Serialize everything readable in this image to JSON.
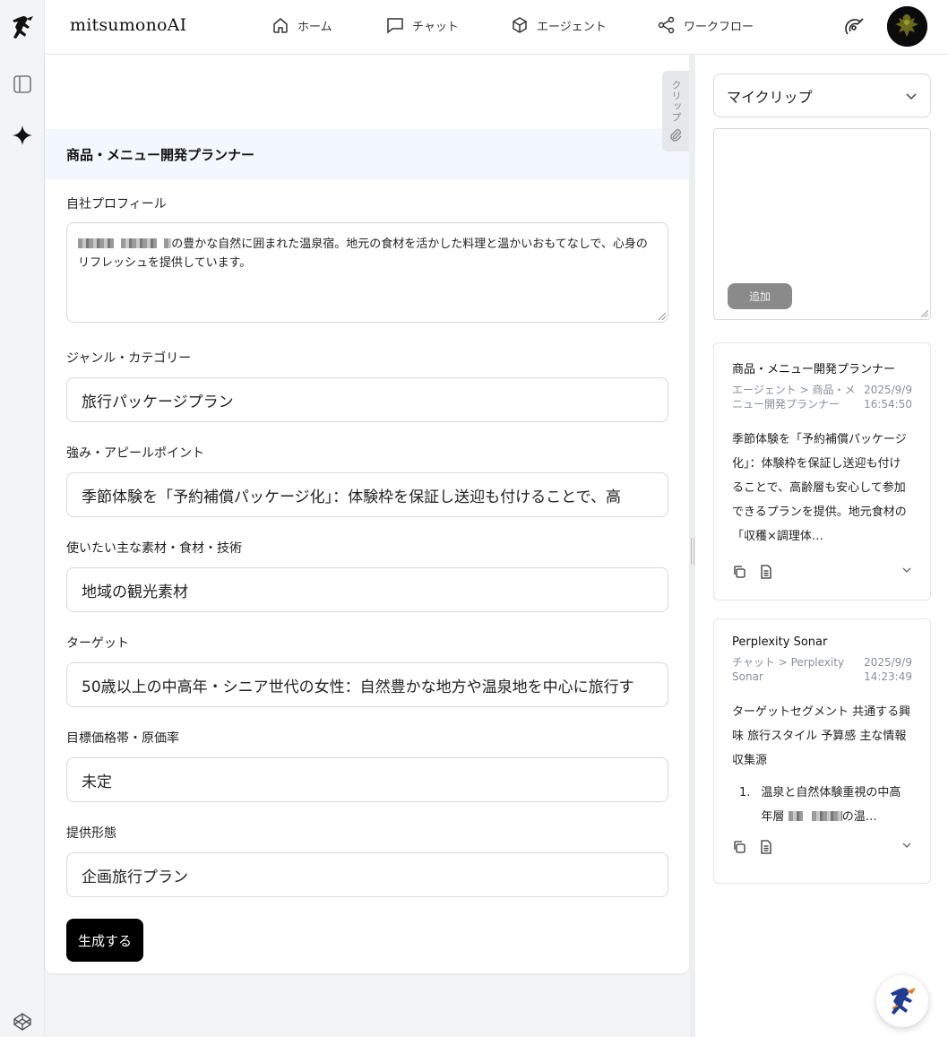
{
  "header": {
    "brand": "mitsumonoAI",
    "nav": [
      {
        "label": "ホーム",
        "icon": "home-icon"
      },
      {
        "label": "チャット",
        "icon": "chat-icon"
      },
      {
        "label": "エージェント",
        "icon": "cube-icon"
      },
      {
        "label": "ワークフロー",
        "icon": "workflow-icon"
      }
    ]
  },
  "clip_tab": {
    "label": "クリップ"
  },
  "form": {
    "title": "商品・メニュー開発プランナー",
    "profile": {
      "label": "自社プロフィール",
      "value": "の豊かな自然に囲まれた温泉宿。地元の食材を活かした料理と温かいおもてなしで、心身のリフレッシュを提供しています。"
    },
    "genre": {
      "label": "ジャンル・カテゴリー",
      "value": "旅行パッケージプラン"
    },
    "strength": {
      "label": "強み・アピールポイント",
      "value": "季節体験を「予約補償パッケージ化」：体験枠を保証し送迎も付けることで、高"
    },
    "materials": {
      "label": "使いたい主な素材・食材・技術",
      "value": "地域の観光素材"
    },
    "target": {
      "label": "ターゲット",
      "value": "50歳以上の中高年・シニア世代の女性：自然豊かな地方や温泉地を中心に旅行す"
    },
    "price": {
      "label": "目標価格帯・原価率",
      "value": "未定"
    },
    "format": {
      "label": "提供形態",
      "value": "企画旅行プラン"
    },
    "generate_label": "生成する"
  },
  "sidebar": {
    "select_value": "マイクリップ",
    "add_label": "追加",
    "cards": [
      {
        "title": "商品・メニュー開発プランナー",
        "path": "エージェント > 商品・メニュー開発プランナー",
        "date": "2025/9/9",
        "time": "16:54:50",
        "body": "季節体験を「予約補償パッケージ化」：体験枠を保証し送迎も付けることで、高齢層も安心して参加できるプランを提供。地元食材の「収穫×調理体…"
      },
      {
        "title": "Perplexity Sonar",
        "path": "チャット > Perplexity Sonar",
        "date": "2025/9/9",
        "time": "14:23:49",
        "body": "ターゲットセグメント 共通する興味 旅行スタイル 予算感 主な情報収集源",
        "list_num": "1.",
        "list_text_a": "温泉と自然体験重視の中高年層",
        "list_text_b": "の温…"
      }
    ]
  }
}
